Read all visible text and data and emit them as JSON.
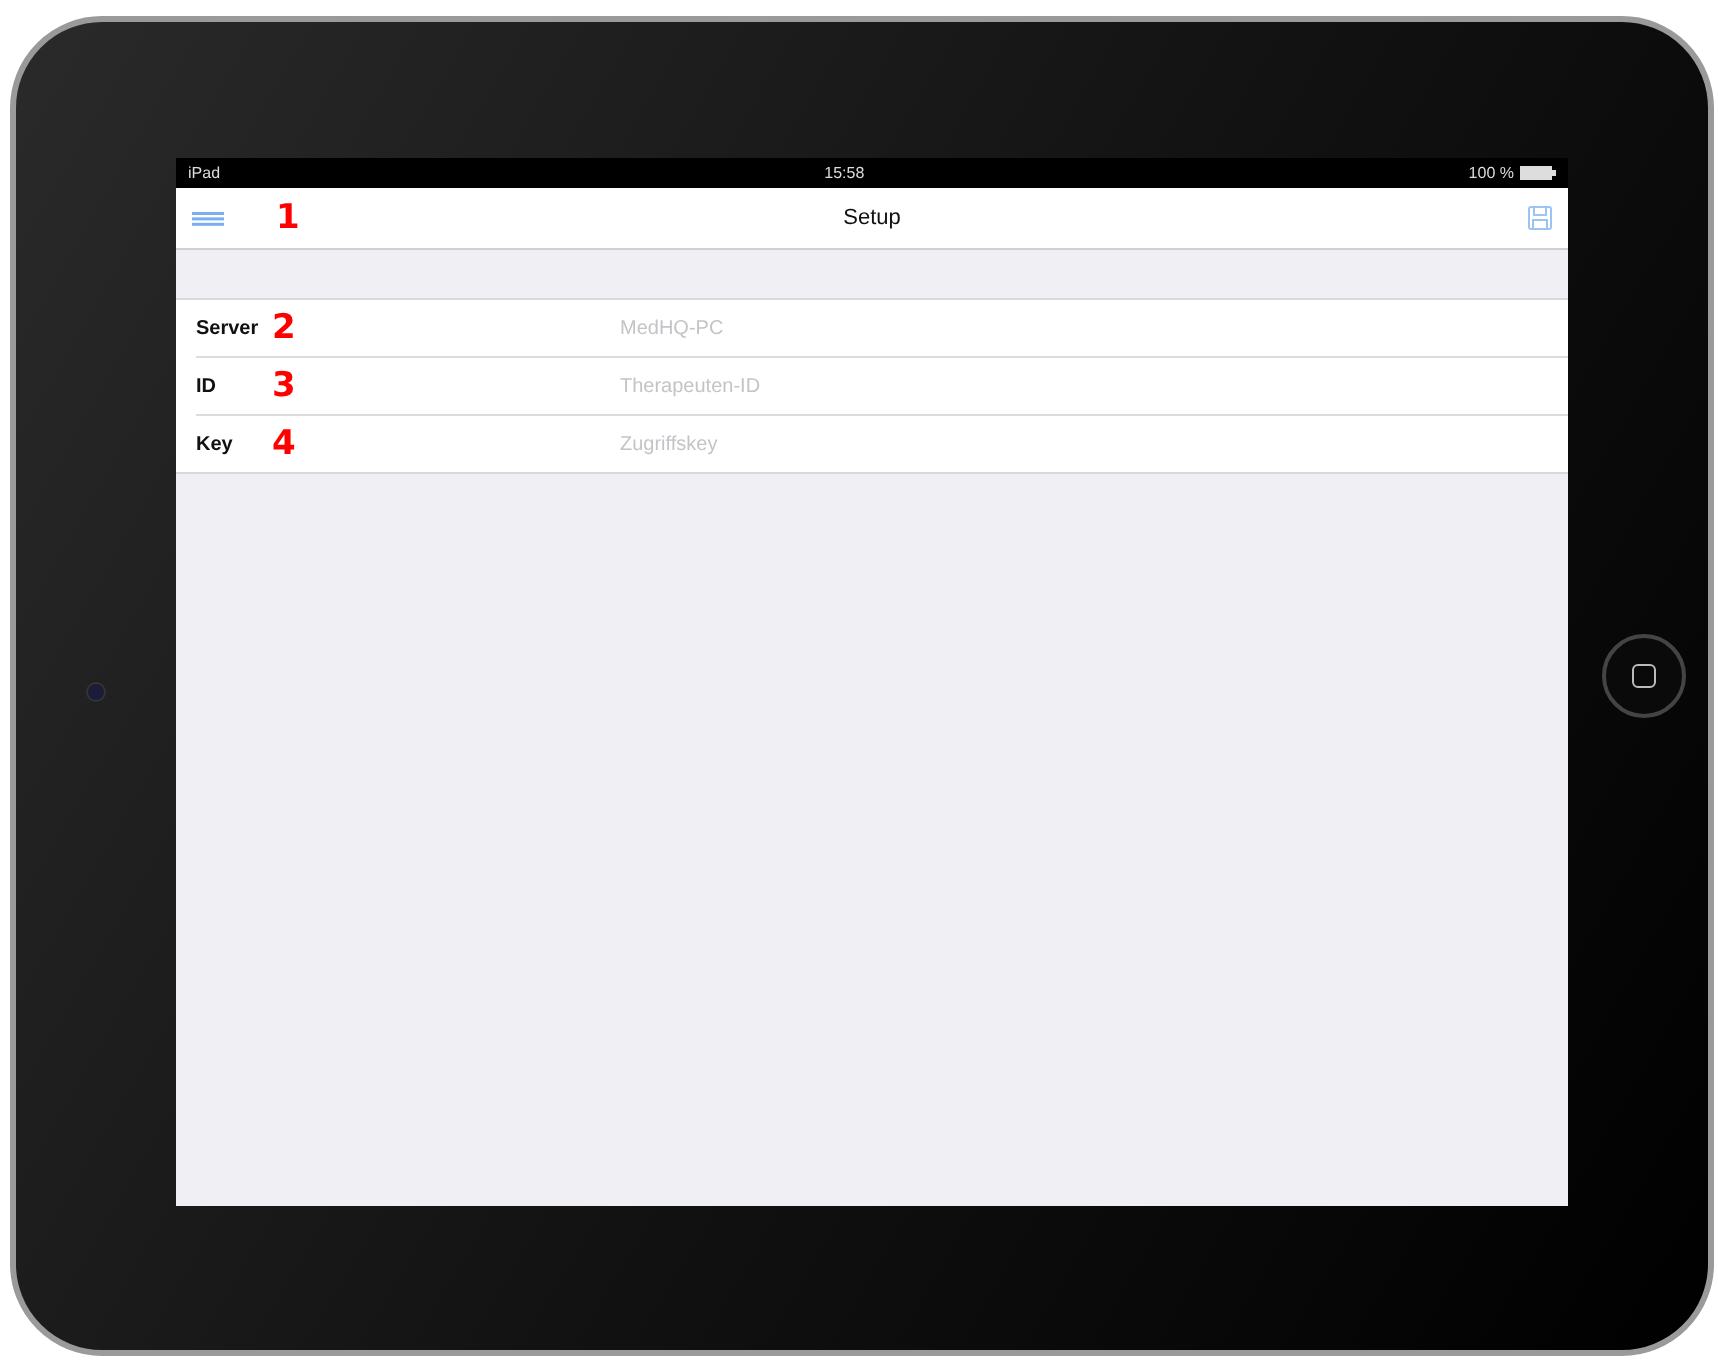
{
  "status_bar": {
    "device": "iPad",
    "time": "15:58",
    "battery": "100 %"
  },
  "nav_bar": {
    "title": "Setup",
    "menu_callout": "1"
  },
  "fields": [
    {
      "label": "Server",
      "callout": "2",
      "placeholder": "MedHQ-PC"
    },
    {
      "label": "ID",
      "callout": "3",
      "placeholder": "Therapeuten-ID"
    },
    {
      "label": "Key",
      "callout": "4",
      "placeholder": "Zugriffskey"
    }
  ]
}
